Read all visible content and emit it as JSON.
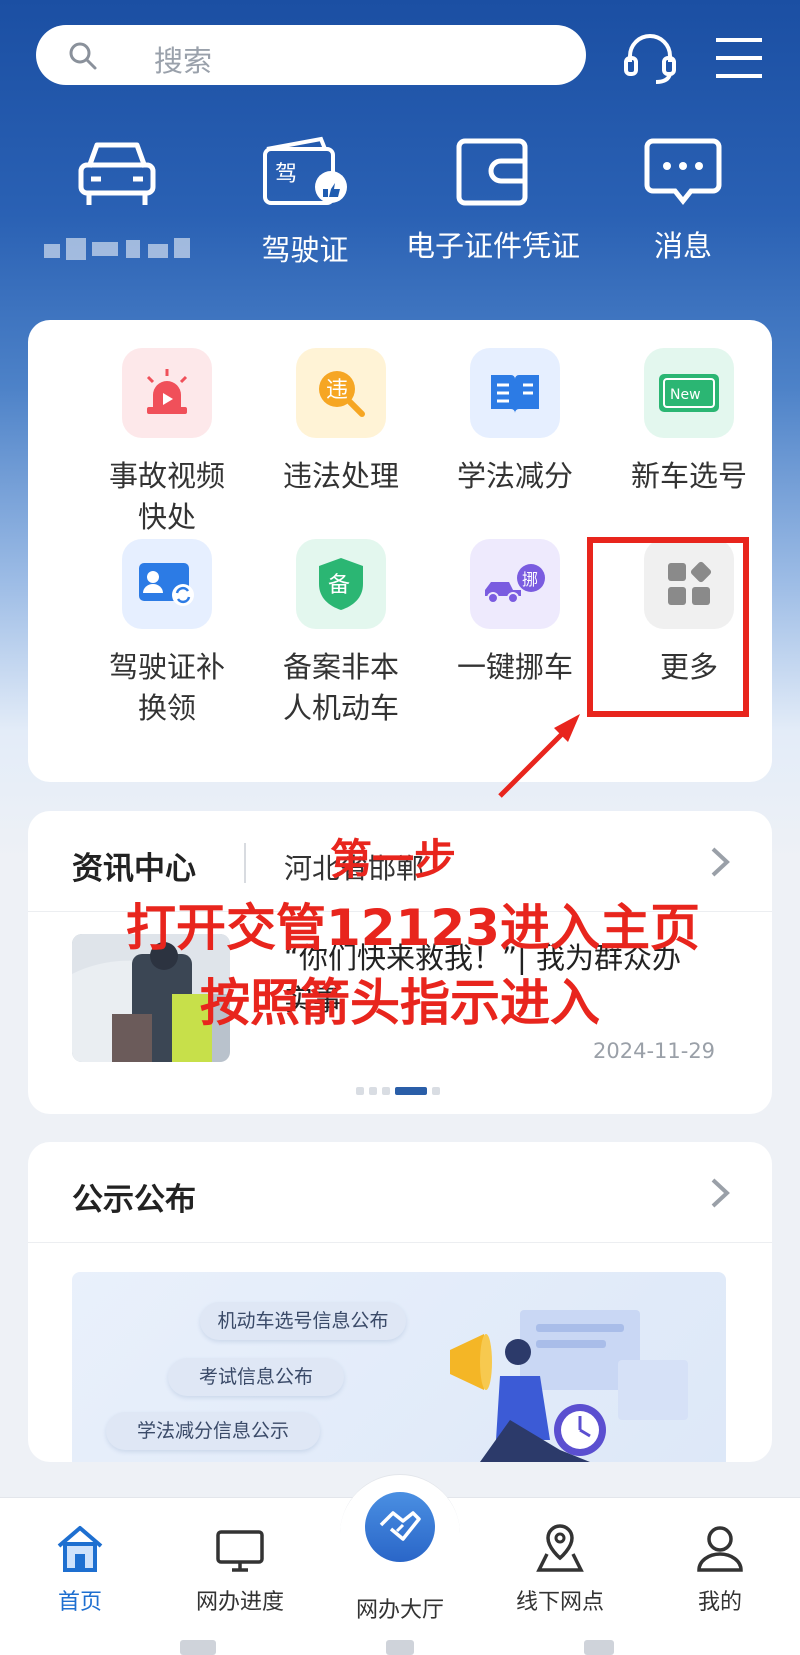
{
  "header": {
    "search_placeholder": "搜索",
    "icons": [
      "search-icon",
      "headset-icon",
      "menu-icon"
    ]
  },
  "quick_actions": [
    {
      "icon": "car-icon",
      "label": ""
    },
    {
      "icon": "driver-license-icon",
      "label": "驾驶证"
    },
    {
      "icon": "wallet-icon",
      "label": "电子证件凭证"
    },
    {
      "icon": "message-icon",
      "label": "消息"
    }
  ],
  "services": [
    {
      "label": "事故视频\n快处",
      "icon": "accident-siren-icon",
      "bg": "#fde8ea",
      "color": "#f0505a"
    },
    {
      "label": "违法处理",
      "icon": "violation-search-icon",
      "bg": "#fff3d6",
      "color": "#f6a623"
    },
    {
      "label": "学法减分",
      "icon": "book-icon",
      "bg": "#e6efff",
      "color": "#2c7be5"
    },
    {
      "label": "新车选号",
      "icon": "new-plate-icon",
      "bg": "#e3f7ee",
      "color": "#2bb673"
    },
    {
      "label": "驾驶证补\n换领",
      "icon": "license-renew-icon",
      "bg": "#e6efff",
      "color": "#2c7be5"
    },
    {
      "label": "备案非本\n人机动车",
      "icon": "shield-record-icon",
      "bg": "#e3f7ee",
      "color": "#2bb673"
    },
    {
      "label": "一键挪车",
      "icon": "tow-truck-icon",
      "bg": "#eeeafd",
      "color": "#7a5ce0"
    },
    {
      "label": "更多",
      "icon": "more-grid-icon",
      "bg": "#f0f0f0",
      "color": "#8a8a8a"
    }
  ],
  "news": {
    "title": "资讯中心",
    "location": "河北省邯郸",
    "headline": "“你们快来救我！”| 我为群众办实事",
    "date": "2024-11-29"
  },
  "notice": {
    "title": "公示公布",
    "banner_items": [
      "机动车选号信息公布",
      "考试信息公布",
      "学法减分信息公示"
    ]
  },
  "annotation": {
    "step": "第一步",
    "line1": "打开交管12123进入主页",
    "line2": "按照箭头指示进入",
    "color": "#e8251d"
  },
  "tabbar": {
    "items": [
      {
        "label": "首页",
        "icon": "home-icon",
        "active": true
      },
      {
        "label": "网办进度",
        "icon": "monitor-icon",
        "active": false
      },
      {
        "label": "网办大厅",
        "icon": "handshake-icon",
        "active": false
      },
      {
        "label": "线下网点",
        "icon": "map-pin-icon",
        "active": false
      },
      {
        "label": "我的",
        "icon": "user-icon",
        "active": false
      }
    ],
    "active_color": "#1e6fd0"
  }
}
